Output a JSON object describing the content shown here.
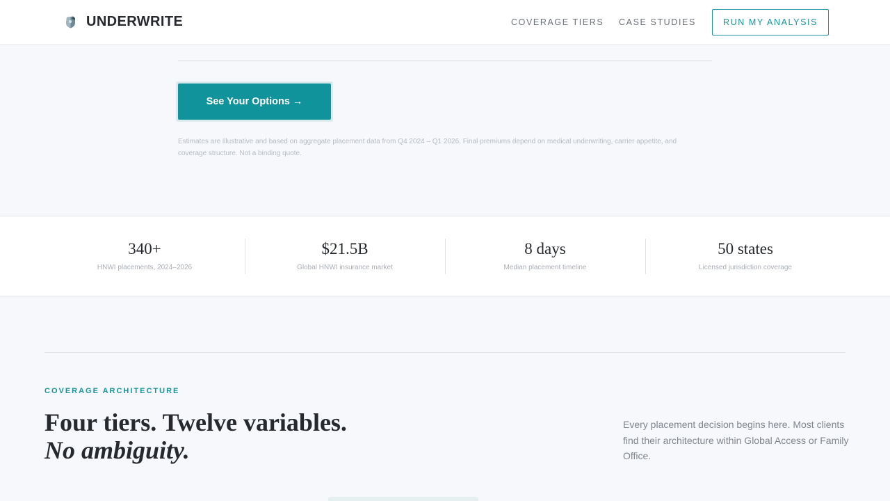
{
  "header": {
    "brand_name": "UNDERWRITE",
    "brand_icon": "shield-logo-icon",
    "nav": [
      {
        "label": "COVERAGE TIERS"
      },
      {
        "label": "CASE STUDIES"
      }
    ],
    "cta_label": "RUN MY ANALYSIS"
  },
  "hero": {
    "cta_label": "See Your Options →",
    "disclaimer": "Estimates are illustrative and based on aggregate placement data from Q4 2024 – Q1 2026. Final premiums depend on medical underwriting, carrier appetite, and coverage structure. Not a binding quote."
  },
  "stats": [
    {
      "value": "340+",
      "label": "HNWI placements, 2024–2026"
    },
    {
      "value": "$21.5B",
      "label": "Global HNWI insurance market"
    },
    {
      "value": "8 days",
      "label": "Median placement timeline"
    },
    {
      "value": "50 states",
      "label": "Licensed jurisdiction coverage"
    }
  ],
  "coverage": {
    "eyebrow": "COVERAGE ARCHITECTURE",
    "headline_line1": "Four tiers. Twelve variables.",
    "headline_line2": "No ambiguity.",
    "description": "Every placement decision begins here. Most clients find their architecture within Global Access or Family Office."
  },
  "colors": {
    "accent": "#17949c",
    "cta_fill": "#10939b",
    "ink": "#26292d",
    "page_background": "#f6f8fb"
  }
}
